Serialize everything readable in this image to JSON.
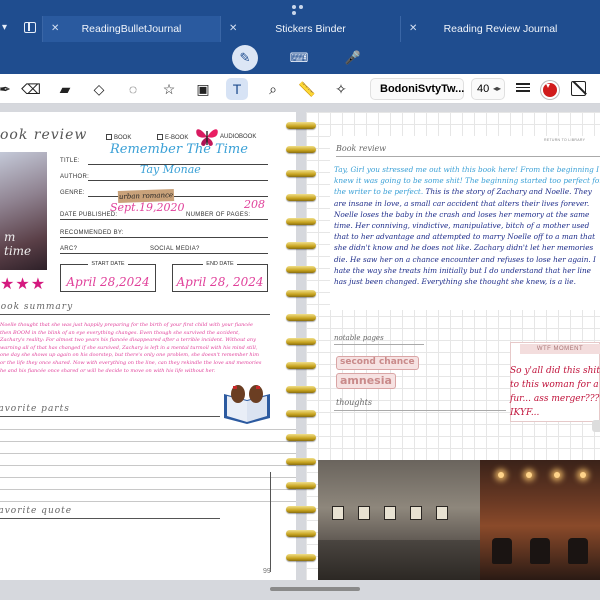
{
  "tabs": [
    {
      "label": "ReadingBulletJournal",
      "active": true
    },
    {
      "label": "Stickers Binder",
      "active": false
    },
    {
      "label": "Reading Review Journal",
      "active": false
    }
  ],
  "toolbar": {
    "font_name": "BodoniSvtyTw...",
    "font_size": "40",
    "color": "#d11c1c"
  },
  "left_page": {
    "heading": "book review",
    "format_options": [
      "BOOK",
      "E-BOOK",
      "AUDIOBOOK"
    ],
    "title_label": "TITLE:",
    "title_value": "Remember The Time",
    "author_label": "AUTHOR:",
    "author_value": "Tay Monae",
    "genre_label": "GENRE:",
    "genre_value": "urban romance",
    "published_label": "DATE PUBLISHED:",
    "published_value": "Sept.19,2020",
    "pages_label": "NUMBER OF PAGES:",
    "pages_value": "208",
    "recommended_label": "RECOMMENDED BY:",
    "arc_label": "ARC?",
    "social_label": "SOCIAL MEDIA?",
    "start_label": "START DATE",
    "start_value": "April 28,2024",
    "end_label": "END DATE",
    "end_value": "April 28, 2024",
    "rating": "★★★",
    "summary_heading": "book summary",
    "summary_text": "Noelle thought that she was just happily preparing for the birth of your first child with your fiancée then BOOM in the blink of an eye everything changes. Even though she survived the accident, Zachary's reality: For almost two years his fiancée disappeared after a terrible incident. Without any warning all of that has changed if she survived, Zachary is left in a mental turmoil with his mind still, one day she shows up again on his doorstep, but there's only one problem, she doesn't remember him or the life they once shared. Now with everything on the line, can they rekindle the love and memories he and his fiancée once shared or will he decide to move on with his life without her.",
    "favorite_heading": "favorite parts",
    "quotes_heading": "favorite quote",
    "page_number": "99"
  },
  "right_page": {
    "heading": "Book review",
    "return_link": "RETURN TO LIBRARY",
    "review_lead": "Tay, Girl you stressed me out with this book here! From the beginning I knew it was going to be some shit! The beginning started too perfect for the writer to be perfect.",
    "review_body": " This is the story of Zachary and Noelle. They are insane in love, a small car accident that alters their lives forever. Noelle loses the baby in the crash and loses her memory at the same time. Her conniving, vindictive, manipulative, bitch of a mother used that to her advantage and attempted to marry Noelle off to a man that she didn't know and he does not like. Zachary didn't let her memories die. He saw her on a chance encounter and refuses to lose her again. I hate the way she treats him initially but I do understand that her line has just been changed. Everything she thought she knew, is a lie.",
    "notable_heading": "notable pages",
    "stickers": [
      "second chance",
      "amnesia"
    ],
    "thoughts_heading": "thoughts",
    "wtf_label": "WTF MOMENT",
    "wtf_text": "So y'all did this shit to this woman for a fur... ass merger??? IKYF..."
  }
}
